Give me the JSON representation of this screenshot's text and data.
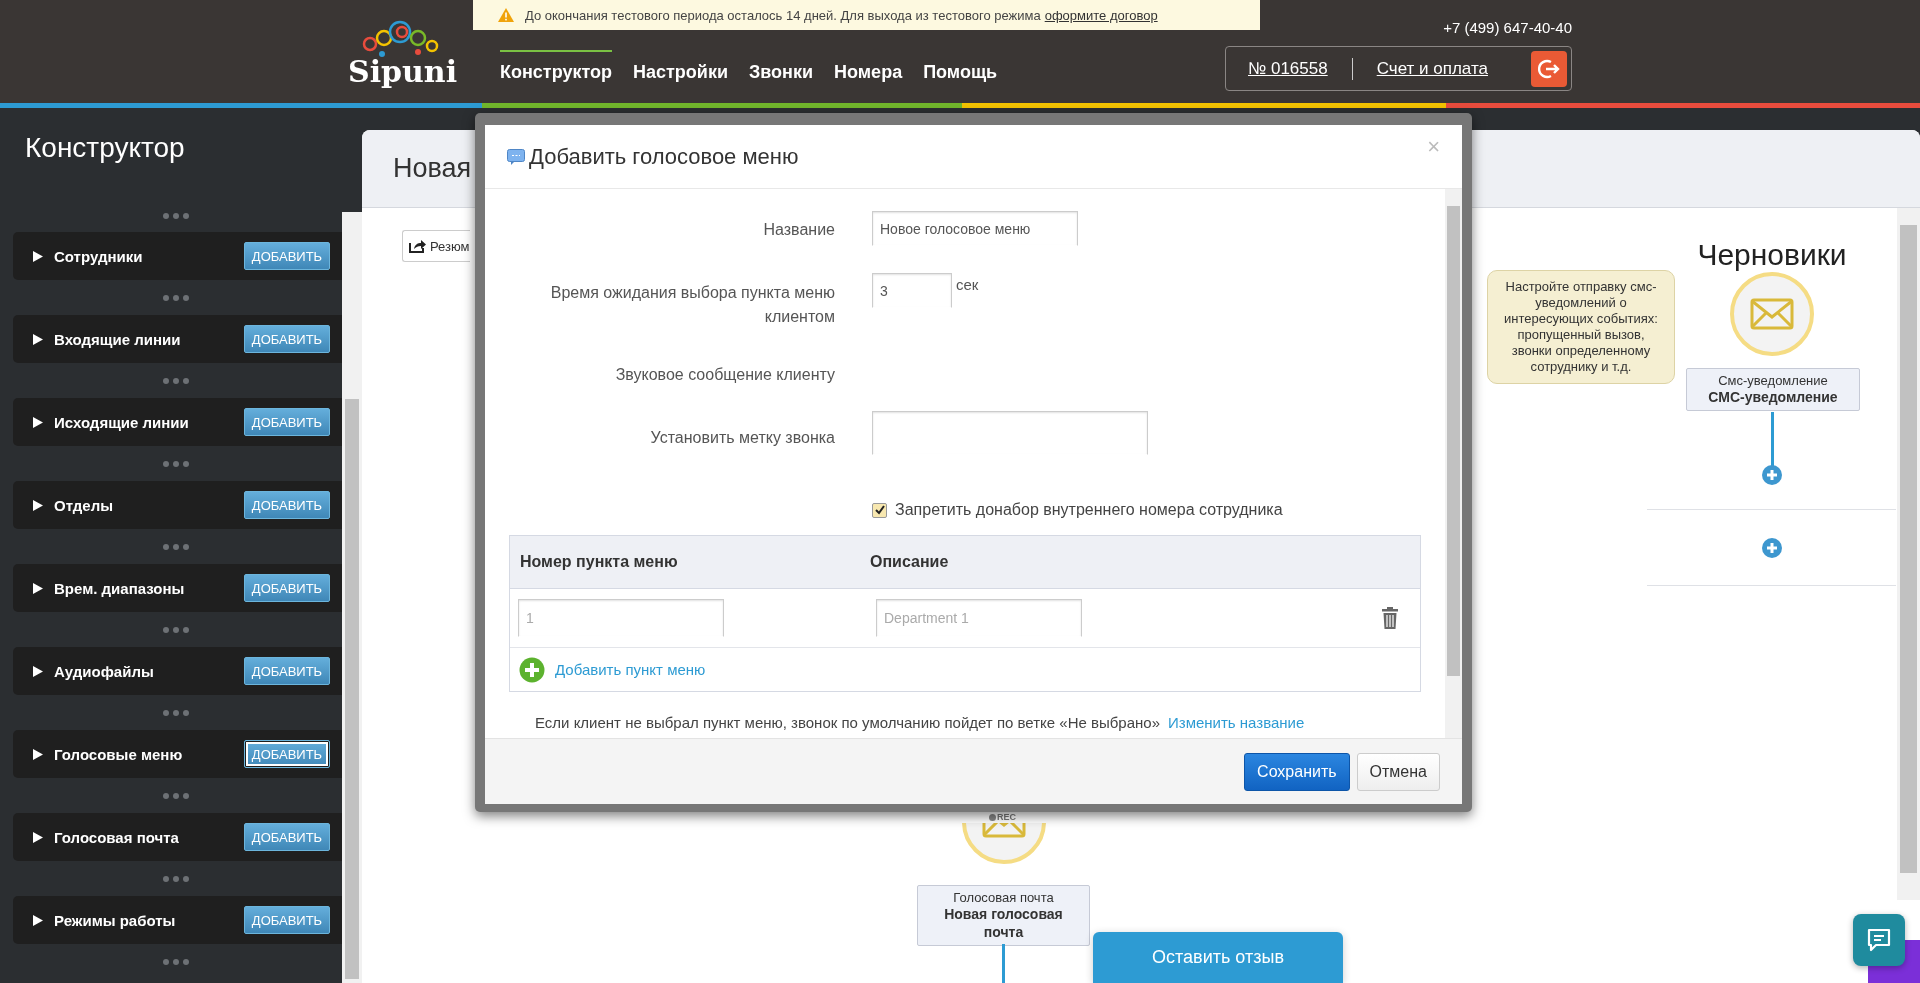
{
  "notice": {
    "text": "До окончания тестового периода осталось 14 дней. Для выхода из тестового режима",
    "link": "оформите договор"
  },
  "logo": {
    "text": "Sipuni"
  },
  "nav": [
    {
      "label": "Конструктор",
      "selected": true
    },
    {
      "label": "Настройки",
      "selected": false
    },
    {
      "label": "Звонки",
      "selected": false
    },
    {
      "label": "Номера",
      "selected": false
    },
    {
      "label": "Помощь",
      "selected": false
    }
  ],
  "phone": "+7 (499) 647-40-40",
  "account": {
    "number": "№ 016558",
    "billing": "Счет и оплата"
  },
  "sidebar": {
    "title": "Конструктор",
    "items": [
      {
        "label": "Сотрудники",
        "button": "ДОБАВИТЬ",
        "focused": false
      },
      {
        "label": "Входящие линии",
        "button": "ДОБАВИТЬ",
        "focused": false
      },
      {
        "label": "Исходящие линии",
        "button": "ДОБАВИТЬ",
        "focused": false
      },
      {
        "label": "Отделы",
        "button": "ДОБАВИТЬ",
        "focused": false
      },
      {
        "label": "Врем. диапазоны",
        "button": "ДОБАВИТЬ",
        "focused": false
      },
      {
        "label": "Аудиофайлы",
        "button": "ДОБАВИТЬ",
        "focused": false
      },
      {
        "label": "Голосовые меню",
        "button": "ДОБАВИТЬ",
        "focused": true
      },
      {
        "label": "Голосовая почта",
        "button": "ДОБАВИТЬ",
        "focused": false
      },
      {
        "label": "Режимы работы",
        "button": "ДОБАВИТЬ",
        "focused": false
      }
    ]
  },
  "panel": {
    "title": "Новая",
    "resume_button": "Резюм"
  },
  "canvas": {
    "drafts_title": "Черновики",
    "tip": "Настройте отправку смс-уведомлений о интересующих событиях: пропущенный вызов, звонки определенному сотруднику и т.д.",
    "sms_node": {
      "type": "Смс-уведомление",
      "name": "СМС-уведомление"
    },
    "voicemail_node": {
      "badge": "REC",
      "type": "Голосовая почта",
      "name": "Новая голосовая почта"
    }
  },
  "modal": {
    "title": "Добавить голосовое меню",
    "close": "×",
    "name_field": {
      "label": "Название",
      "value": "Новое голосовое меню"
    },
    "timeout_field": {
      "label": "Время ожидания выбора пункта меню клиентом",
      "value": "3",
      "unit": "сек"
    },
    "sound_field": {
      "label": "Звуковое сообщение клиенту"
    },
    "tag_field": {
      "label": "Установить метку звонка"
    },
    "checkbox": {
      "label": "Запретить донабор внутреннего номера сотрудника",
      "checked": true
    },
    "table": {
      "columns": [
        "Номер пункта меню",
        "Описание"
      ],
      "rows": [
        {
          "number_placeholder": "1",
          "description_placeholder": "Department 1"
        }
      ],
      "add_link": "Добавить пункт меню"
    },
    "note": {
      "text": "Если клиент не выбрал пункт меню, звонок по умолчанию пойдет по ветке «Не выбрано»",
      "link": "Изменить название"
    },
    "save_button": "Сохранить",
    "cancel_button": "Отмена"
  },
  "feedback_button": "Оставить отзыв"
}
